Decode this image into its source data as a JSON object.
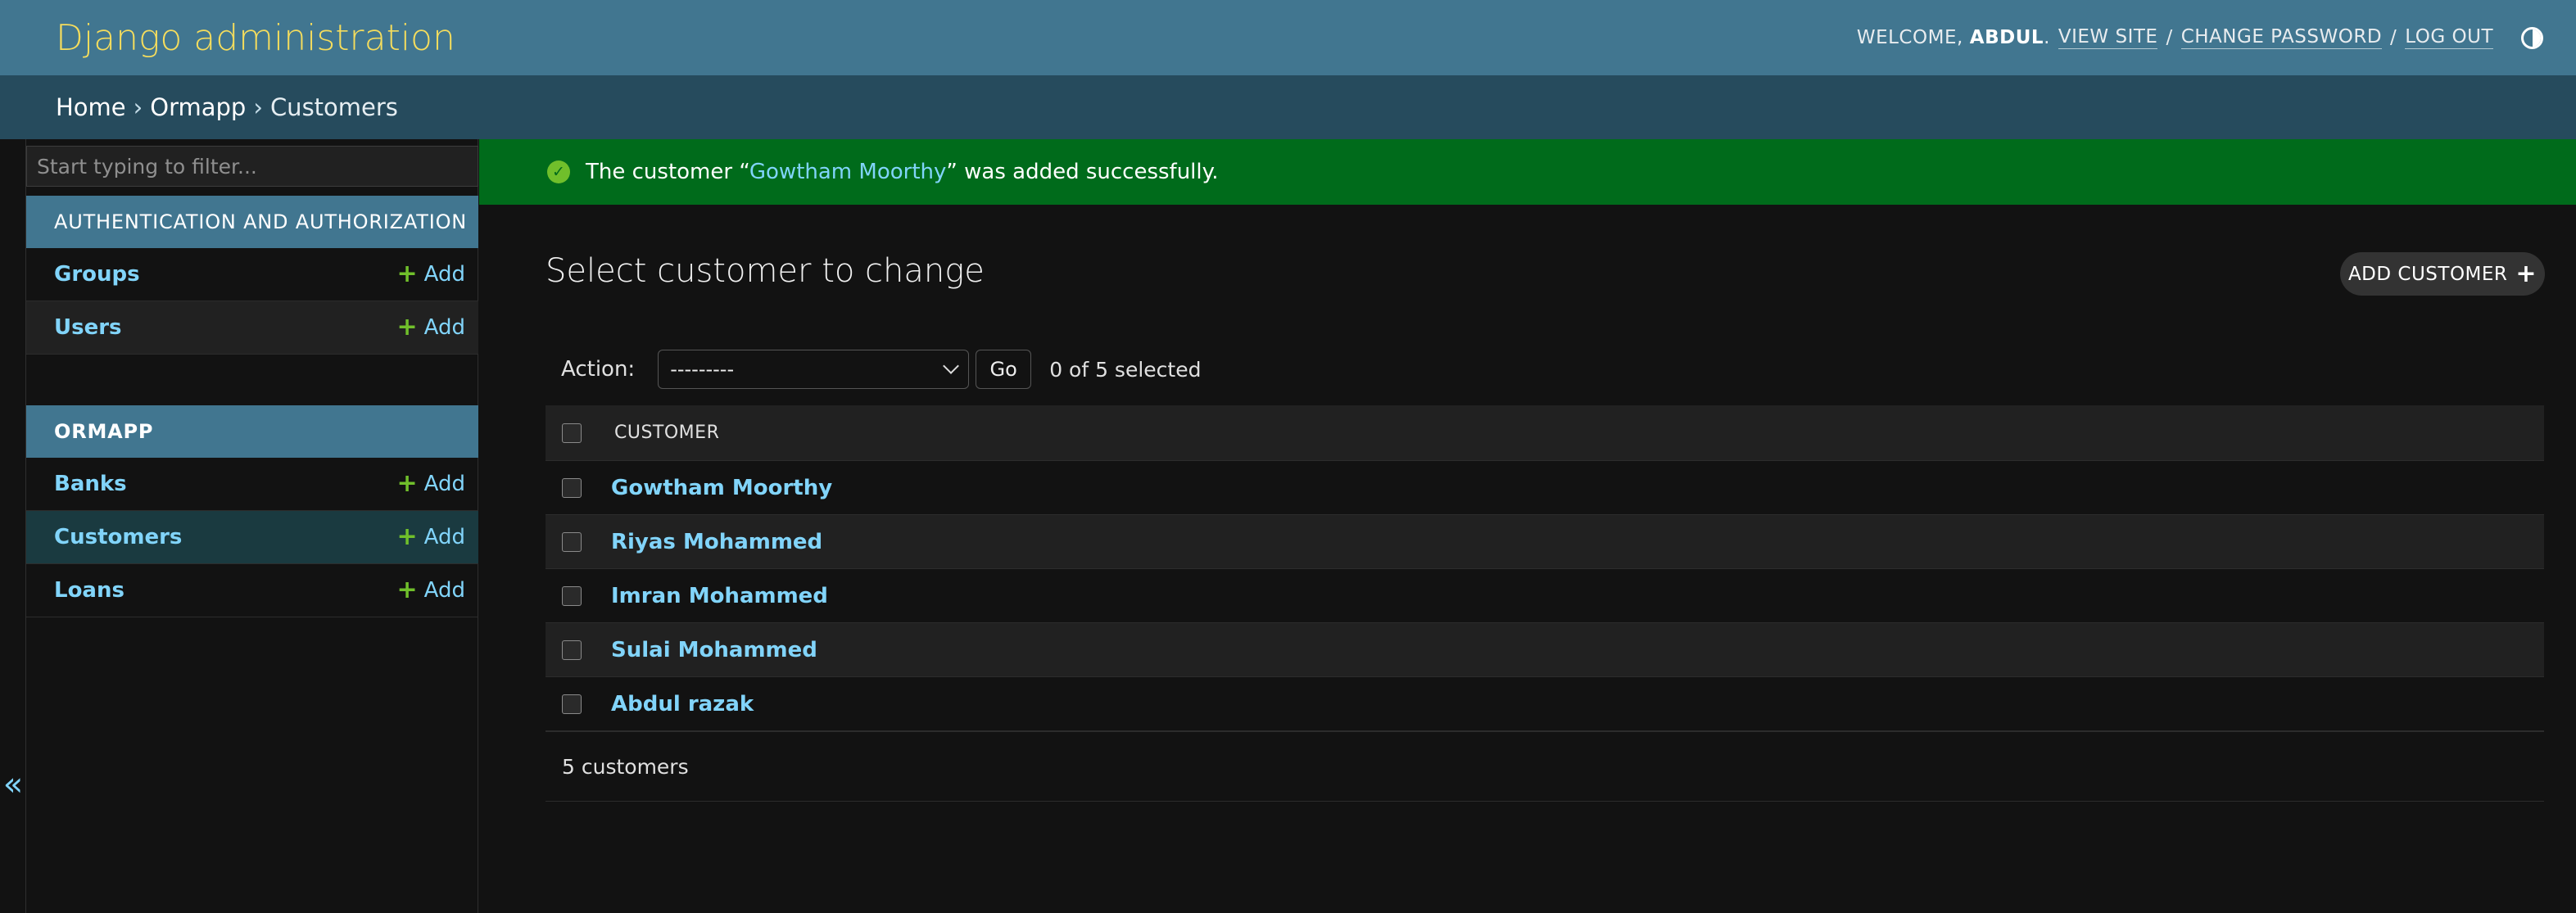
{
  "header": {
    "branding": "Django administration",
    "welcome": "WELCOME,",
    "username": "ABDUL",
    "view_site": "VIEW SITE",
    "change_password": "CHANGE PASSWORD",
    "log_out": "LOG OUT",
    "separator": "/",
    "period": "."
  },
  "breadcrumbs": {
    "home": "Home",
    "app": "Ormapp",
    "current": "Customers",
    "sep": "›"
  },
  "sidebar": {
    "filter_placeholder": "Start typing to filter...",
    "add_label": "Add",
    "modules": [
      {
        "caption": "AUTHENTICATION AND AUTHORIZATION",
        "models": [
          "Groups",
          "Users"
        ]
      },
      {
        "caption": "ORMAPP",
        "models": [
          "Banks",
          "Customers",
          "Loans"
        ]
      }
    ],
    "collapse_icon": "«"
  },
  "message": {
    "prefix": "The customer “",
    "link": "Gowtham Moorthy",
    "suffix": "” was added successfully."
  },
  "content": {
    "title": "Select customer to change",
    "add_button": "ADD CUSTOMER",
    "action_label": "Action:",
    "action_selected": "---------",
    "go": "Go",
    "selected_count": "0 of 5 selected",
    "column_header": "CUSTOMER",
    "rows": [
      "Gowtham Moorthy",
      "Riyas Mohammed",
      "Imran Mohammed",
      "Sulai Mohammed",
      "Abdul razak"
    ],
    "paginator": "5 customers"
  },
  "colors": {
    "header_bg": "#417690",
    "breadcrumbs_bg": "#264b5d",
    "branding": "#f5dd5d",
    "link": "#81d4fa",
    "success_bg": "#006b1b",
    "add_plus": "#70bf2b"
  }
}
